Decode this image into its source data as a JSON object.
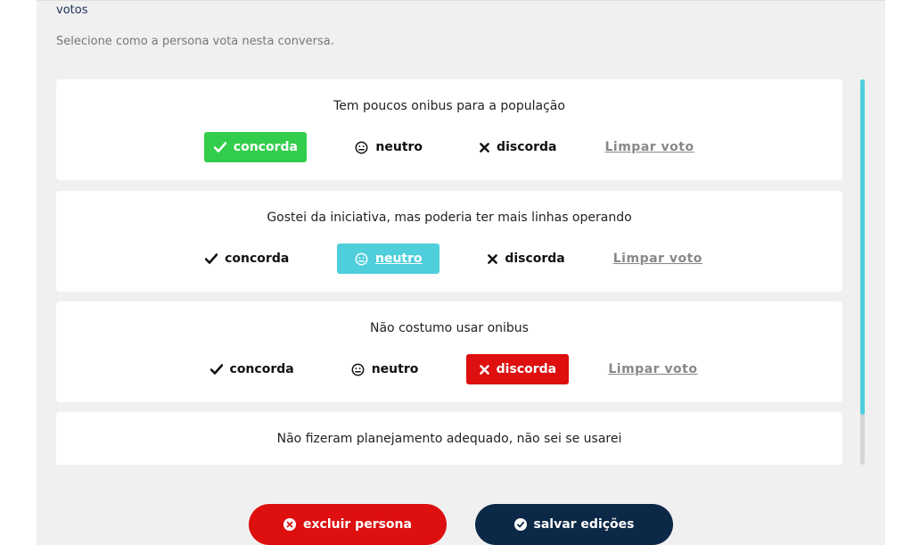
{
  "section": {
    "title": "votos",
    "description": "Selecione como a persona vota nesta conversa."
  },
  "vote_labels": {
    "agree": "concorda",
    "pass": "neutro",
    "disagree": "discorda",
    "clear": "Limpar voto"
  },
  "comments": [
    {
      "text": "Tem poucos onibus para a população",
      "selected_vote": "concorda"
    },
    {
      "text": "Gostei da iniciativa, mas poderia ter mais linhas operando",
      "selected_vote": "neutro"
    },
    {
      "text": "Não costumo usar onibus",
      "selected_vote": "discorda"
    },
    {
      "text": "Não fizeram planejamento adequado, não sei se usarei"
    }
  ],
  "actions": {
    "delete_label": "excluir persona",
    "save_label": "salvar edições"
  },
  "colors": {
    "agree": "#32cd4b",
    "pass": "#4fcedb",
    "disagree": "#dd0f0f",
    "primary_dark": "#0b2847",
    "scroll_thumb": "#4fcedb"
  },
  "icons": {
    "agree": "check-icon",
    "pass": "smiley-neutral-icon",
    "disagree": "x-icon",
    "delete": "circle-x-icon",
    "save": "circle-check-icon"
  }
}
